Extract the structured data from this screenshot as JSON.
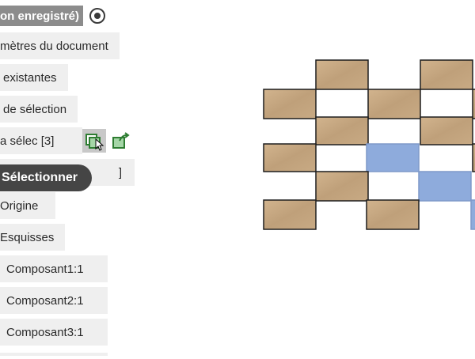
{
  "panel": {
    "title": "on enregistré)",
    "doc_params": "mètres du document",
    "existing": "existantes",
    "selection": "de sélection",
    "ma_selec": "a sélec [3]",
    "hidden_suffix": "]",
    "origin": "Origine",
    "sketches": "Esquisses",
    "components": [
      "Composant1:1",
      "Composant2:1",
      "Composant3:1"
    ]
  },
  "tooltip": {
    "label": "Sélectionner"
  },
  "icons": {
    "radio": "radio-selected-icon",
    "select_set": "select-set-icon",
    "export_set": "export-set-icon",
    "cursor": "mouse-cursor-icon"
  },
  "colors": {
    "wood": "#c9ab84",
    "selected": "#8eabdc",
    "chip": "#efefef",
    "tooltip": "#454545"
  }
}
